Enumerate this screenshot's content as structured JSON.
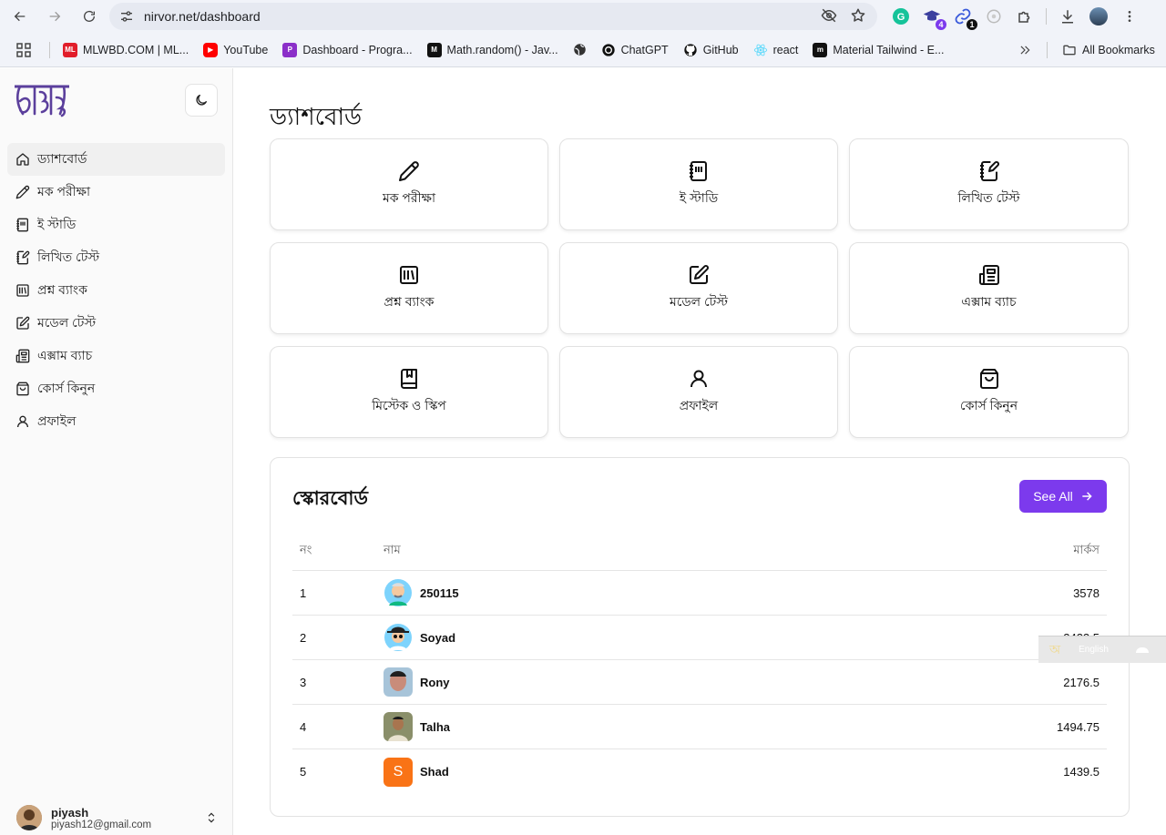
{
  "browser": {
    "url": "nirvor.net/dashboard",
    "ext_badge_1": "4",
    "ext_badge_2": "1",
    "bookmarks": [
      {
        "label": "MLWBD.COM | ML...",
        "color": "#e11d2a",
        "icon": "mlwbd-icon"
      },
      {
        "label": "YouTube",
        "color": "#ff0000",
        "icon": "youtube-icon"
      },
      {
        "label": "Dashboard - Progra...",
        "color": "#8b2fc9",
        "icon": "programiz-icon"
      },
      {
        "label": "Math.random() - Jav...",
        "color": "#111111",
        "icon": "mdn-icon"
      },
      {
        "label": "",
        "color": "#333333",
        "icon": "globe-icon"
      },
      {
        "label": "ChatGPT",
        "color": "#111111",
        "icon": "chatgpt-icon"
      },
      {
        "label": "GitHub",
        "color": "#111111",
        "icon": "github-icon"
      },
      {
        "label": "react",
        "color": "#61dafb",
        "icon": "react-icon"
      },
      {
        "label": "Material Tailwind - E...",
        "color": "#111111",
        "icon": "material-tailwind-icon"
      }
    ],
    "all_bookmarks": "All Bookmarks"
  },
  "sidebar": {
    "items": [
      {
        "label": "ড্যাশবোর্ড",
        "icon": "home-icon"
      },
      {
        "label": "মক পরীক্ষা",
        "icon": "pencil-icon"
      },
      {
        "label": "ই স্টাডি",
        "icon": "notebook-icon"
      },
      {
        "label": "লিখিত টেস্ট",
        "icon": "notebook-pen-icon"
      },
      {
        "label": "প্রশ্ন ব্যাংক",
        "icon": "library-icon"
      },
      {
        "label": "মডেল টেস্ট",
        "icon": "square-pen-icon"
      },
      {
        "label": "এক্সাম ব্যাচ",
        "icon": "newspaper-icon"
      },
      {
        "label": "কোর্স কিনুন",
        "icon": "shopping-bag-icon"
      },
      {
        "label": "প্রফাইল",
        "icon": "user-icon"
      }
    ],
    "user": {
      "name": "piyash",
      "email": "piyash12@gmail.com"
    }
  },
  "main": {
    "title": "ড্যাশবোর্ড",
    "cards": [
      {
        "label": "মক পরীক্ষা",
        "icon": "pencil-icon"
      },
      {
        "label": "ই স্টাডি",
        "icon": "notebook-icon"
      },
      {
        "label": "লিখিত টেস্ট",
        "icon": "notebook-pen-icon"
      },
      {
        "label": "প্রশ্ন ব্যাংক",
        "icon": "library-icon"
      },
      {
        "label": "মডেল টেস্ট",
        "icon": "square-pen-icon"
      },
      {
        "label": "এক্সাম ব্যাচ",
        "icon": "newspaper-icon"
      },
      {
        "label": "মিস্টেক ও স্কিপ",
        "icon": "book-marked-icon"
      },
      {
        "label": "প্রফাইল",
        "icon": "user-icon"
      },
      {
        "label": "কোর্স কিনুন",
        "icon": "shopping-bag-icon"
      }
    ]
  },
  "scoreboard": {
    "title": "স্কোরবোর্ড",
    "see_all": "See All",
    "headers": {
      "rank": "নং",
      "name": "নাম",
      "marks": "মার্কস"
    },
    "rows": [
      {
        "rank": "1",
        "name": "250115",
        "marks": "3578"
      },
      {
        "rank": "2",
        "name": "Soyad",
        "marks": "2422.5"
      },
      {
        "rank": "3",
        "name": "Rony",
        "marks": "2176.5"
      },
      {
        "rank": "4",
        "name": "Talha",
        "marks": "1494.75"
      },
      {
        "rank": "5",
        "name": "Shad",
        "marks": "1439.5",
        "initial": "S"
      }
    ]
  },
  "lang_popup": {
    "label": "English"
  },
  "colors": {
    "accent": "#7c3aed",
    "shad_avatar": "#f97316"
  }
}
